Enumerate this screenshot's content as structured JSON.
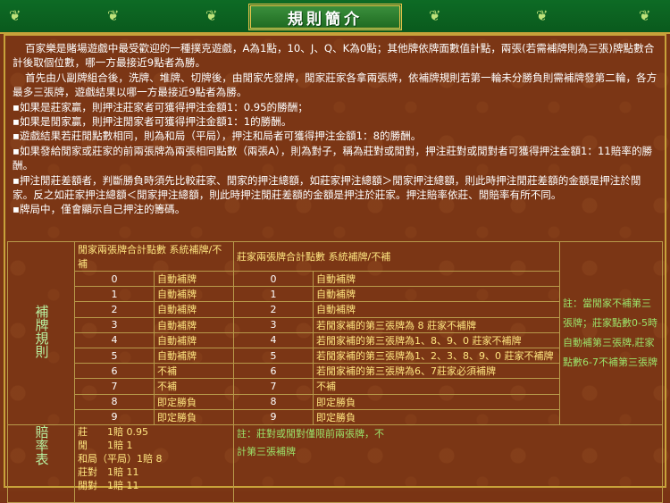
{
  "title": "規則簡介",
  "intro": {
    "p1": "百家樂是賭場遊戲中最受歡迎的一種撲克遊戲，A為1點，10、J、Q、K為0點；其他牌依牌面數值計點，兩張(若需補牌則為三張)牌點數合計後取個位數，哪一方最接近9點者為勝。",
    "p2": "首先由八副牌組合後，洗牌、堆牌、切牌後，由閒家先發牌，閒家莊家各拿兩張牌，依補牌規則若第一輪未分勝負則需補牌發第二輪，各方最多三張牌，遊戲結果以哪一方最接近9點者為勝。",
    "b1": "▪如果是莊家贏，則押注莊家者可獲得押注金額1：0.95的勝酬；",
    "b2": "▪如果是閒家贏，則押注閒家者可獲得押注金額1：1的勝酬。",
    "b3": "▪遊戲結果若莊閒點數相同，則為和局（平局），押注和局者可獲得押注金額1：8的勝酬。",
    "b4": "▪如果發給閒家或莊家的前兩張牌為兩張相同點數（兩張A），則為對子，稱為莊對或閒對，押注莊對或閒對者可獲得押注金額1：11賠率的勝酬。",
    "b5": "▪押注閒莊差額者，判斷勝負時須先比較莊家、閒家的押注總額，如莊家押注總額＞閒家押注總額，則此時押注閒莊差額的金額是押注於閒家。反之如莊家押注總額＜閒家押注總額，則此時押注閒莊差額的金額是押注於莊家。押注賠率依莊、閒賠率有所不同。",
    "b6": "▪牌局中，僅會顯示自己押注的籌碼。"
  },
  "supplement": {
    "side_label": "補牌規則",
    "player_header_points": "閒家兩張牌合計點數",
    "player_header_rule": "系統補牌/不補",
    "banker_header_points": "莊家兩張牌合計點數",
    "banker_header_rule": "系統補牌/不補",
    "rows": [
      {
        "p": "0",
        "pr": "自動補牌",
        "b": "0",
        "br": "自動補牌"
      },
      {
        "p": "1",
        "pr": "自動補牌",
        "b": "1",
        "br": "自動補牌"
      },
      {
        "p": "2",
        "pr": "自動補牌",
        "b": "2",
        "br": "自動補牌"
      },
      {
        "p": "3",
        "pr": "自動補牌",
        "b": "3",
        "br": "若閒家補的第三張牌為 8 莊家不補牌"
      },
      {
        "p": "4",
        "pr": "自動補牌",
        "b": "4",
        "br": "若閒家補的第三張牌為1、8、9、0 莊家不補牌"
      },
      {
        "p": "5",
        "pr": "自動補牌",
        "b": "5",
        "br": "若閒家補的第三張牌為1、2、3、8、9、0 莊家不補牌"
      },
      {
        "p": "6",
        "pr": "不補",
        "b": "6",
        "br": "若閒家補的第三張牌為6、7莊家必須補牌"
      },
      {
        "p": "7",
        "pr": "不補",
        "b": "7",
        "br": "不補"
      },
      {
        "p": "8",
        "pr": "即定勝負",
        "b": "8",
        "br": "即定勝負"
      },
      {
        "p": "9",
        "pr": "即定勝負",
        "b": "9",
        "br": "即定勝負"
      }
    ],
    "note": "註：當閒家不補第三張牌；莊家點數0-5時自動補第三張牌,莊家點數6-7不補第三張牌"
  },
  "payout": {
    "side_label": "賠率表",
    "items": [
      "莊　　1賠 0.95",
      "閒　　1賠 1",
      "和局（平局）1賠 8",
      "莊對　1賠 11",
      "閒對　1賠 11"
    ],
    "note": "註：莊對或閒對僅限前兩張牌，不計第三張補牌"
  }
}
